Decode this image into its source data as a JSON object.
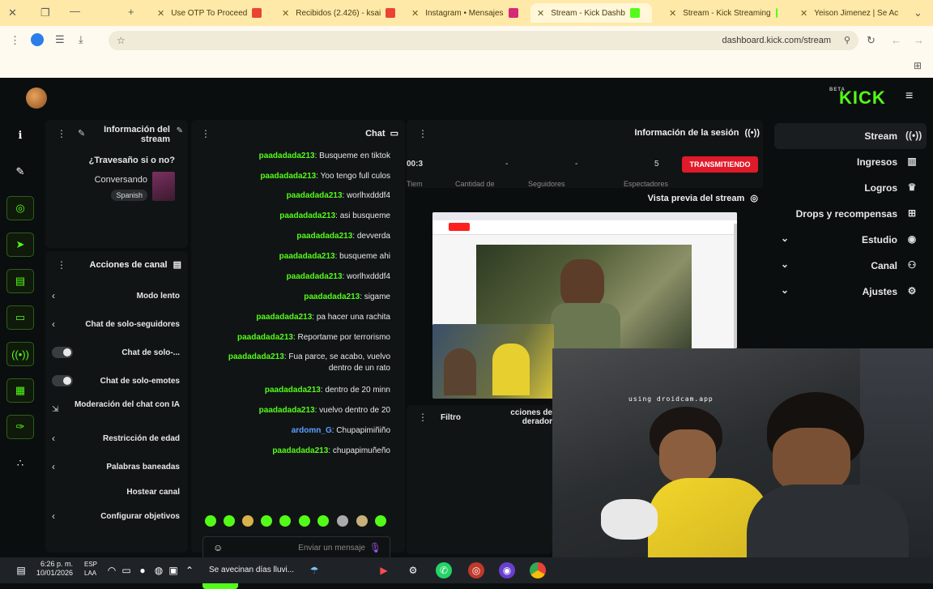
{
  "browser": {
    "tabs": [
      {
        "label": "Yeison Jimenez | Se Ac",
        "color": "#ff1e1e"
      },
      {
        "label": "Stream - Kick Streaming",
        "color": "#53fc18"
      },
      {
        "label": "Stream - Kick Dashb",
        "color": "#53fc18"
      },
      {
        "label": "Instagram • Mensajes",
        "color": "#d62976"
      },
      {
        "label": "Recibidos (2.426) - ksai",
        "color": "#ea4335"
      },
      {
        "label": "Use OTP To Proceed",
        "color": "#ea4335"
      }
    ],
    "url": "dashboard.kick.com/stream"
  },
  "app": {
    "logo": "KICK",
    "logo_sup": "BETA"
  },
  "nav": [
    {
      "label": "Stream",
      "icon": "broadcast-icon",
      "glyph": "(•)",
      "selected": true
    },
    {
      "label": "Ingresos",
      "icon": "chart-icon",
      "glyph": "▥"
    },
    {
      "label": "Logros",
      "icon": "trophy-icon",
      "glyph": "🏆"
    },
    {
      "label": "Drops y recompensas",
      "icon": "gift-icon",
      "glyph": "⊞"
    },
    {
      "label": "Estudio",
      "icon": "studio-icon",
      "glyph": "◉",
      "expand": true
    },
    {
      "label": "Canal",
      "icon": "users-icon",
      "glyph": "⚇",
      "expand": true
    },
    {
      "label": "Ajustes",
      "icon": "gear-icon",
      "glyph": "⚙",
      "expand": true
    }
  ],
  "session": {
    "title": "Información de la sesión",
    "badge": "TRANSMITIENDO",
    "stats": [
      "5",
      "-",
      "-",
      "00:3"
    ],
    "labels": [
      "Espectadores",
      "Seguidores",
      "Cantidad de",
      "Tiem"
    ]
  },
  "preview": {
    "title": "Vista previa del stream",
    "overlay_text": "using droidcam.app"
  },
  "chat": {
    "title": "Chat",
    "messages": [
      {
        "user": "paadadada213",
        "text": ": Busqueme en tiktok"
      },
      {
        "user": "paadadada213",
        "text": ": Yoo tengo full culos"
      },
      {
        "user": "paadadada213",
        "text": ": worlhxdddf4"
      },
      {
        "user": "paadadada213",
        "text": ": asi busqueme"
      },
      {
        "user": "paadadada213",
        "text": ": devverda"
      },
      {
        "user": "paadadada213",
        "text": ": busqueme ahi"
      },
      {
        "user": "paadadada213",
        "text": ": worlhxdddf4"
      },
      {
        "user": "paadadada213",
        "text": ": sigame"
      },
      {
        "user": "paadadada213",
        "text": ": pa hacer una rachita"
      },
      {
        "user": "paadadada213",
        "text": ": Reportame por terrorismo"
      },
      {
        "user": "paadadada213",
        "text": ": Fua parce, se acabo, vuelvo dentro de un rato"
      },
      {
        "user": "paadadada213",
        "text": ": dentro de 20 minn"
      },
      {
        "user": "paadadada213",
        "text": ": vuelvo dentro de 20"
      },
      {
        "user": "ardomn_G",
        "text": ": Chupapimiñiño",
        "alt": true
      },
      {
        "user": "paadadada213",
        "text": ": chupapimuñeño"
      }
    ],
    "placeholder": "Enviar un mensaje",
    "send_label": "Chat"
  },
  "stream_info": {
    "title_line1": "Información del",
    "title_line2": "stream",
    "stream_title": "¿Travesaño si o no?",
    "category": "Conversando",
    "language": "Spanish"
  },
  "actions": {
    "title": "Acciones de canal",
    "items": [
      {
        "label": "Modo lento",
        "type": "chevron"
      },
      {
        "label": "Chat de solo-seguidores",
        "type": "chevron"
      },
      {
        "label": "Chat de solo-...",
        "type": "toggle"
      },
      {
        "label": "Chat de solo-emotes",
        "type": "toggle"
      },
      {
        "label": "Moderación del chat con IA",
        "type": "external"
      },
      {
        "label": "Restricción de edad",
        "type": "chevron"
      },
      {
        "label": "Palabras baneadas",
        "type": "chevron"
      },
      {
        "label": "Hostear canal",
        "type": "none"
      },
      {
        "label": "Configurar objetivos",
        "type": "chevron"
      }
    ]
  },
  "mod": {
    "title_line1": "cciones de",
    "title_line2": "derador",
    "filter": "Filtro"
  },
  "taskbar": {
    "weather": "Se avecinan días lluvi...",
    "lang": "ESP",
    "lang2": "LAA",
    "time": "6:26 p. m.",
    "date": "10/01/2026"
  }
}
